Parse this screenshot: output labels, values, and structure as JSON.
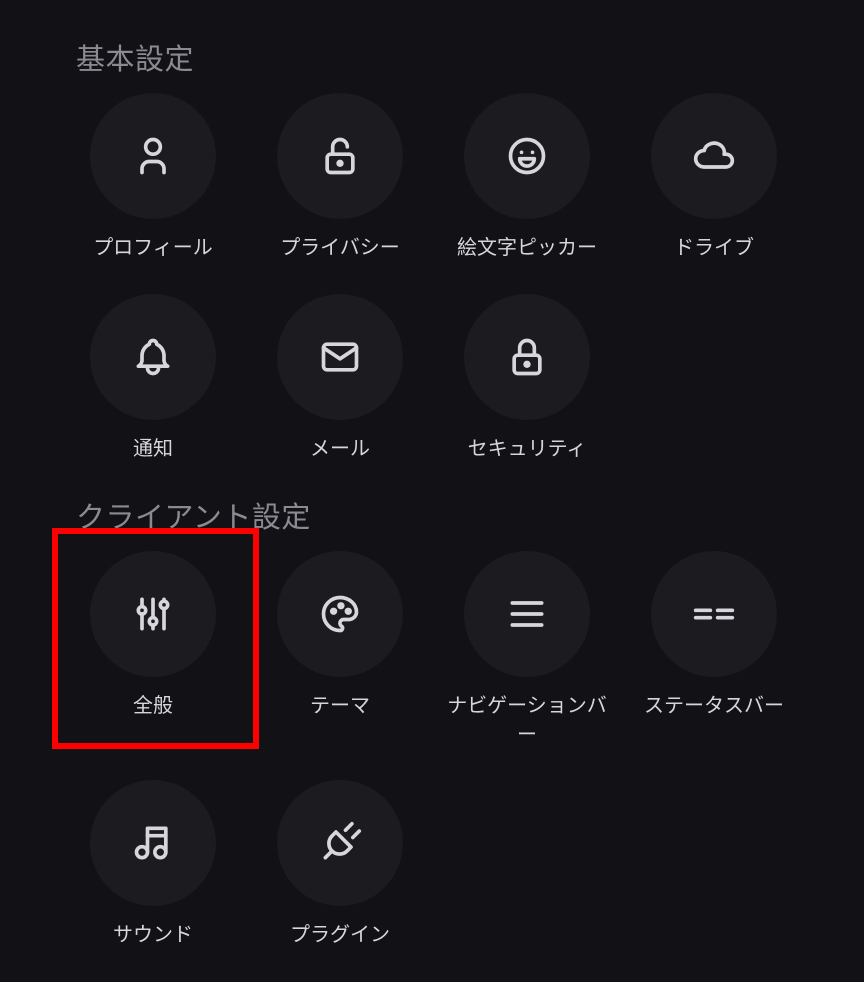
{
  "sections": {
    "basic": {
      "title": "基本設定",
      "items": [
        {
          "label": "プロフィール",
          "icon": "user-icon"
        },
        {
          "label": "プライバシー",
          "icon": "lock-open-icon"
        },
        {
          "label": "絵文字ピッカー",
          "icon": "mood-smile-icon"
        },
        {
          "label": "ドライブ",
          "icon": "cloud-icon"
        },
        {
          "label": "通知",
          "icon": "bell-icon"
        },
        {
          "label": "メール",
          "icon": "mail-icon"
        },
        {
          "label": "セキュリティ",
          "icon": "lock-icon"
        }
      ]
    },
    "client": {
      "title": "クライアント設定",
      "items": [
        {
          "label": "全般",
          "icon": "adjustments-icon"
        },
        {
          "label": "テーマ",
          "icon": "palette-icon"
        },
        {
          "label": "ナビゲーションバー",
          "icon": "menu-icon"
        },
        {
          "label": "ステータスバー",
          "icon": "equal-icon"
        },
        {
          "label": "サウンド",
          "icon": "music-icon"
        },
        {
          "label": "プラグイン",
          "icon": "plug-icon"
        }
      ]
    }
  },
  "colors": {
    "background": "#111116",
    "tile": "#1b1b20",
    "text": "#d6d6dc",
    "section_title": "#8a8a92",
    "highlight": "#ff0000"
  }
}
